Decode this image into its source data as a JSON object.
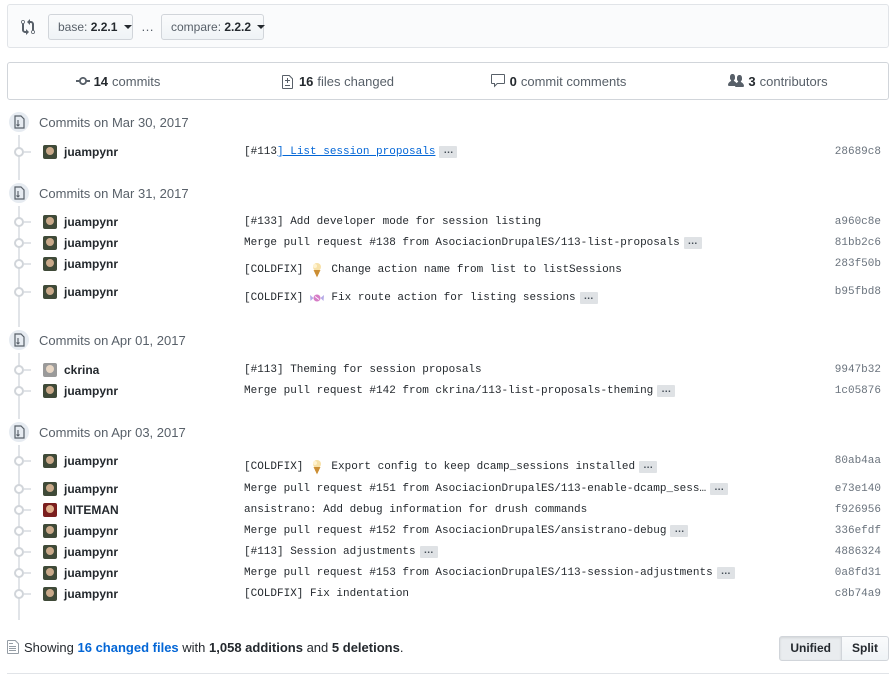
{
  "compare": {
    "base_label": "base:",
    "base_value": "2.2.1",
    "compare_label": "compare:",
    "compare_value": "2.2.2",
    "separator": "…"
  },
  "summary": {
    "commits_count": "14",
    "commits_label": "commits",
    "files_count": "16",
    "files_label": "files changed",
    "comments_count": "0",
    "comments_label": "commit comments",
    "contributors_count": "3",
    "contributors_label": "contributors"
  },
  "groups": [
    {
      "title": "Commits on Mar 30, 2017",
      "commits": [
        {
          "author": "juampynr",
          "message_prefix": "[#113",
          "message_link": "] List session proposals",
          "sha": "28689c8",
          "more": true
        }
      ]
    },
    {
      "title": "Commits on Mar 31, 2017",
      "commits": [
        {
          "author": "juampynr",
          "message": "[#133] Add developer mode for session listing",
          "sha": "a960c8e"
        },
        {
          "author": "juampynr",
          "message": "Merge pull request #138 from AsociacionDrupalES/113-list-proposals",
          "sha": "81bb2c6",
          "more": true
        },
        {
          "author": "juampynr",
          "message_prefix": "[COLDFIX]",
          "emoji": "ice-cream-icon",
          "message": "Change action name from list to listSessions",
          "sha": "283f50b"
        },
        {
          "author": "juampynr",
          "message_prefix": "[COLDFIX]",
          "emoji": "candy-icon",
          "message": "Fix route action for listing sessions",
          "sha": "b95fbd8",
          "more": true
        }
      ]
    },
    {
      "title": "Commits on Apr 01, 2017",
      "commits": [
        {
          "author": "ckrina",
          "message": "[#113] Theming for session proposals",
          "sha": "9947b32"
        },
        {
          "author": "juampynr",
          "message": "Merge pull request #142 from ckrina/113-list-proposals-theming",
          "sha": "1c05876",
          "more": true
        }
      ]
    },
    {
      "title": "Commits on Apr 03, 2017",
      "commits": [
        {
          "author": "juampynr",
          "message_prefix": "[COLDFIX]",
          "emoji": "ice-cream-icon",
          "message": "Export config to keep dcamp_sessions installed",
          "sha": "80ab4aa",
          "more": true
        },
        {
          "author": "juampynr",
          "message": "Merge pull request #151 from AsociacionDrupalES/113-enable-dcamp_sess…",
          "sha": "e73e140",
          "more": true
        },
        {
          "author": "NITEMAN",
          "message": "ansistrano: Add debug information for drush commands",
          "sha": "f926956"
        },
        {
          "author": "juampynr",
          "message": "Merge pull request #152 from AsociacionDrupalES/ansistrano-debug",
          "sha": "336efdf",
          "more": true
        },
        {
          "author": "juampynr",
          "message": "[#113] Session adjustments",
          "sha": "4886324",
          "more": true
        },
        {
          "author": "juampynr",
          "message": "Merge pull request #153 from AsociacionDrupalES/113-session-adjustments",
          "sha": "0a8fd31",
          "more": true
        },
        {
          "author": "juampynr",
          "message": "[COLDFIX] Fix indentation",
          "sha": "c8b74a9"
        }
      ]
    }
  ],
  "toc": {
    "showing": "Showing",
    "changed_files": "16 changed files",
    "with": "with",
    "additions": "1,058 additions",
    "and": "and",
    "deletions": "5 deletions",
    "period": ".",
    "unified_label": "Unified",
    "split_label": "Split"
  },
  "more_label": "…"
}
